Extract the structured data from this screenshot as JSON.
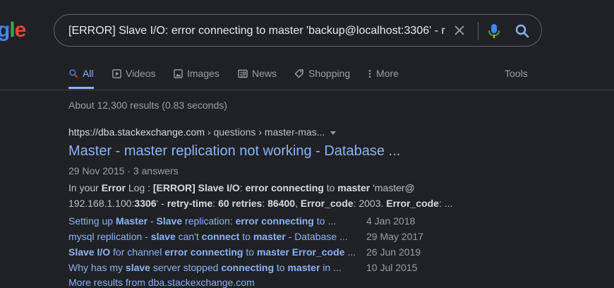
{
  "logo": {
    "text_g": "g",
    "text_l": "l",
    "text_e": "e"
  },
  "search": {
    "query": "[ERROR] Slave I/O: error connecting to master 'backup@localhost:3306' - r"
  },
  "tabs": [
    {
      "label": "All",
      "active": true
    },
    {
      "label": "Videos"
    },
    {
      "label": "Images"
    },
    {
      "label": "News"
    },
    {
      "label": "Shopping"
    },
    {
      "label": "More"
    },
    {
      "label": "Tools"
    }
  ],
  "stats": "About 12,300 results (0.83 seconds)",
  "result": {
    "cite_domain": "https://dba.stackexchange.com",
    "cite_path": " › questions › master-mas...",
    "title": "Master - master replication not working - Database ...",
    "meta": "29 Nov 2015 · 3 answers",
    "snippet": {
      "p1": "In your ",
      "b1": "Error",
      "p2": " Log : ",
      "b2": "[ERROR] Slave I/O",
      "p3": ": ",
      "b3": "error connecting",
      "p4": " to ",
      "b4": "master",
      "p5": " 'master@",
      "p6": "192.168.1.100:",
      "b5": "3306",
      "p7": "' - ",
      "b6": "retry-time",
      "p8": ": ",
      "b7": "60 retries",
      "p9": ": ",
      "b8": "86400",
      "p10": ", ",
      "b9": "Error_code",
      "p11": ": 2003. ",
      "b10": "Error_code",
      "p12": ": ..."
    },
    "sitelinks": [
      {
        "parts": [
          {
            "t": "Setting up ",
            "b": false
          },
          {
            "t": "Master",
            "b": true
          },
          {
            "t": " - ",
            "b": false
          },
          {
            "t": "Slave",
            "b": true
          },
          {
            "t": " replication: ",
            "b": false
          },
          {
            "t": "error connecting",
            "b": true
          },
          {
            "t": " to ...",
            "b": false
          }
        ],
        "date": "4 Jan 2018"
      },
      {
        "parts": [
          {
            "t": "mysql replication - ",
            "b": false
          },
          {
            "t": "slave",
            "b": true
          },
          {
            "t": " can't ",
            "b": false
          },
          {
            "t": "connect",
            "b": true
          },
          {
            "t": " to ",
            "b": false
          },
          {
            "t": "master",
            "b": true
          },
          {
            "t": " - Database ...",
            "b": false
          }
        ],
        "date": "29 May 2017"
      },
      {
        "parts": [
          {
            "t": "Slave I/O",
            "b": true
          },
          {
            "t": " for channel ",
            "b": false
          },
          {
            "t": "error connecting",
            "b": true
          },
          {
            "t": " to ",
            "b": false
          },
          {
            "t": "master Error_code",
            "b": true
          },
          {
            "t": " ...",
            "b": false
          }
        ],
        "date": "26 Jun 2019"
      },
      {
        "parts": [
          {
            "t": "Why has my ",
            "b": false
          },
          {
            "t": "slave",
            "b": true
          },
          {
            "t": " server stopped ",
            "b": false
          },
          {
            "t": "connecting",
            "b": true
          },
          {
            "t": " to ",
            "b": false
          },
          {
            "t": "master",
            "b": true
          },
          {
            "t": " in ...",
            "b": false
          }
        ],
        "date": "10 Jul 2015"
      }
    ],
    "more_results": "More results from dba.stackexchange.com"
  },
  "colors": {
    "background": "#202124",
    "link": "#8ab4f8",
    "text": "#bdc1c6",
    "muted": "#9aa0a6"
  }
}
